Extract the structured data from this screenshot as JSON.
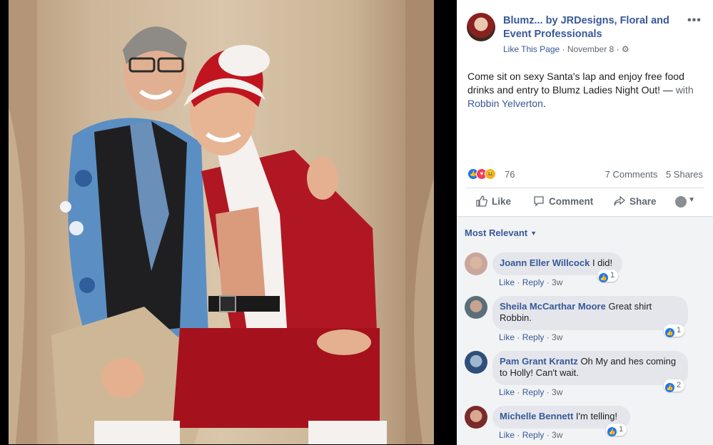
{
  "post": {
    "page_name": "Blumz... by JRDesigns, Floral and Event Professionals",
    "like_page": "Like This Page",
    "date": "November 8",
    "text": "Come sit on sexy Santa's lap and enjoy free food drinks and entry to Blumz Ladies Night Out! — ",
    "with_label": "with ",
    "tagged": "Robbin Yelverton",
    "reaction_count": "76",
    "comments_count": "7 Comments",
    "shares_count": "5 Shares"
  },
  "actions": {
    "like": "Like",
    "comment": "Comment",
    "share": "Share"
  },
  "sort_label": "Most Relevant",
  "comments": [
    {
      "author": "Joann Eller Willcock",
      "text": "I did!",
      "like": "Like",
      "reply": "Reply",
      "time": "3w",
      "likes": "1"
    },
    {
      "author": "Sheila McCarthar Moore",
      "text": "Great shirt Robbin.",
      "like": "Like",
      "reply": "Reply",
      "time": "3w",
      "likes": "1"
    },
    {
      "author": "Pam Grant Krantz",
      "text": "Oh My and hes coming to Holly! Can't wait.",
      "like": "Like",
      "reply": "Reply",
      "time": "3w",
      "likes": "2"
    },
    {
      "author": "Michelle Bennett",
      "text": "I'm telling!",
      "like": "Like",
      "reply": "Reply",
      "time": "3w",
      "likes": "1"
    }
  ],
  "colors": {
    "link": "#385898",
    "like_blue": "#1877f2",
    "love_red": "#f33e58",
    "haha_yellow": "#f7b125"
  },
  "icons": [
    "more-options-icon",
    "gear-icon",
    "like-reaction-icon",
    "love-reaction-icon",
    "haha-reaction-icon",
    "thumbs-up-icon",
    "comment-icon",
    "share-icon",
    "chevron-down-icon"
  ]
}
